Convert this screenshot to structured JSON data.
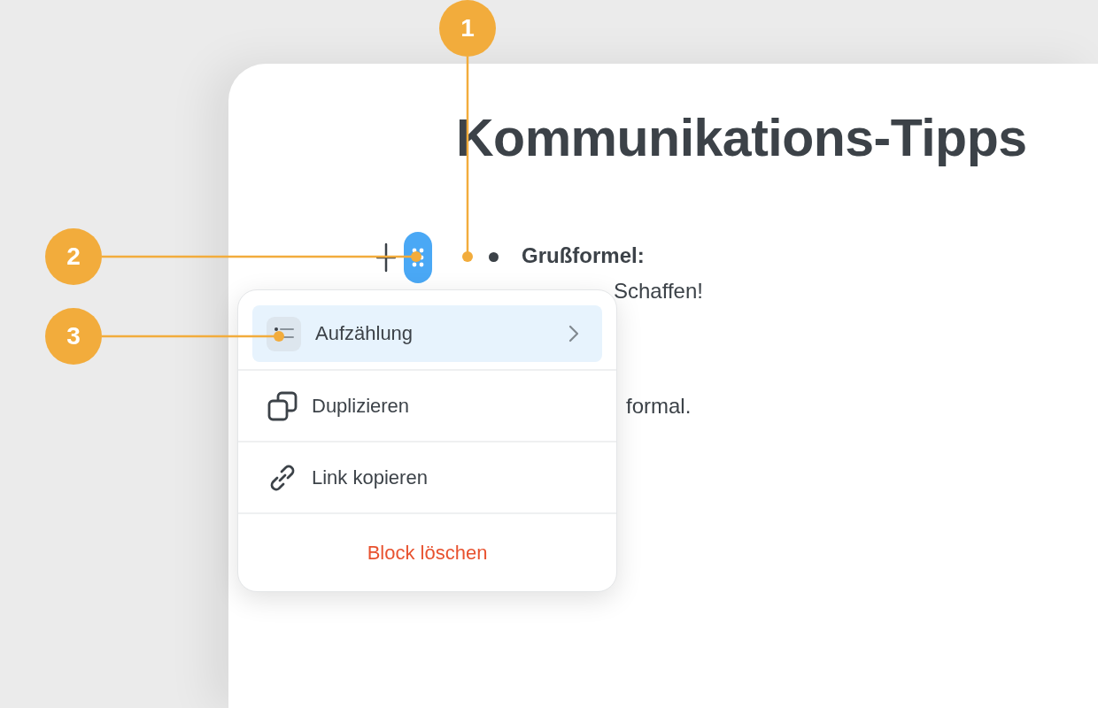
{
  "document": {
    "title": "Kommunikations-Tipps",
    "bullet": {
      "label": "Grußformel:",
      "continuation": "Schaffen!"
    },
    "paragraph": "formal."
  },
  "block_handle": {
    "selected": true
  },
  "menu": {
    "items": [
      {
        "kind": "submenu",
        "label": "Aufzählung",
        "selected": true
      },
      {
        "kind": "duplicate",
        "label": "Duplizieren",
        "selected": false
      },
      {
        "kind": "link",
        "label": "Link kopieren",
        "selected": false
      },
      {
        "kind": "danger",
        "label": "Block löschen",
        "selected": false
      }
    ]
  },
  "callouts": [
    {
      "number": "1"
    },
    {
      "number": "2"
    },
    {
      "number": "3"
    }
  ]
}
